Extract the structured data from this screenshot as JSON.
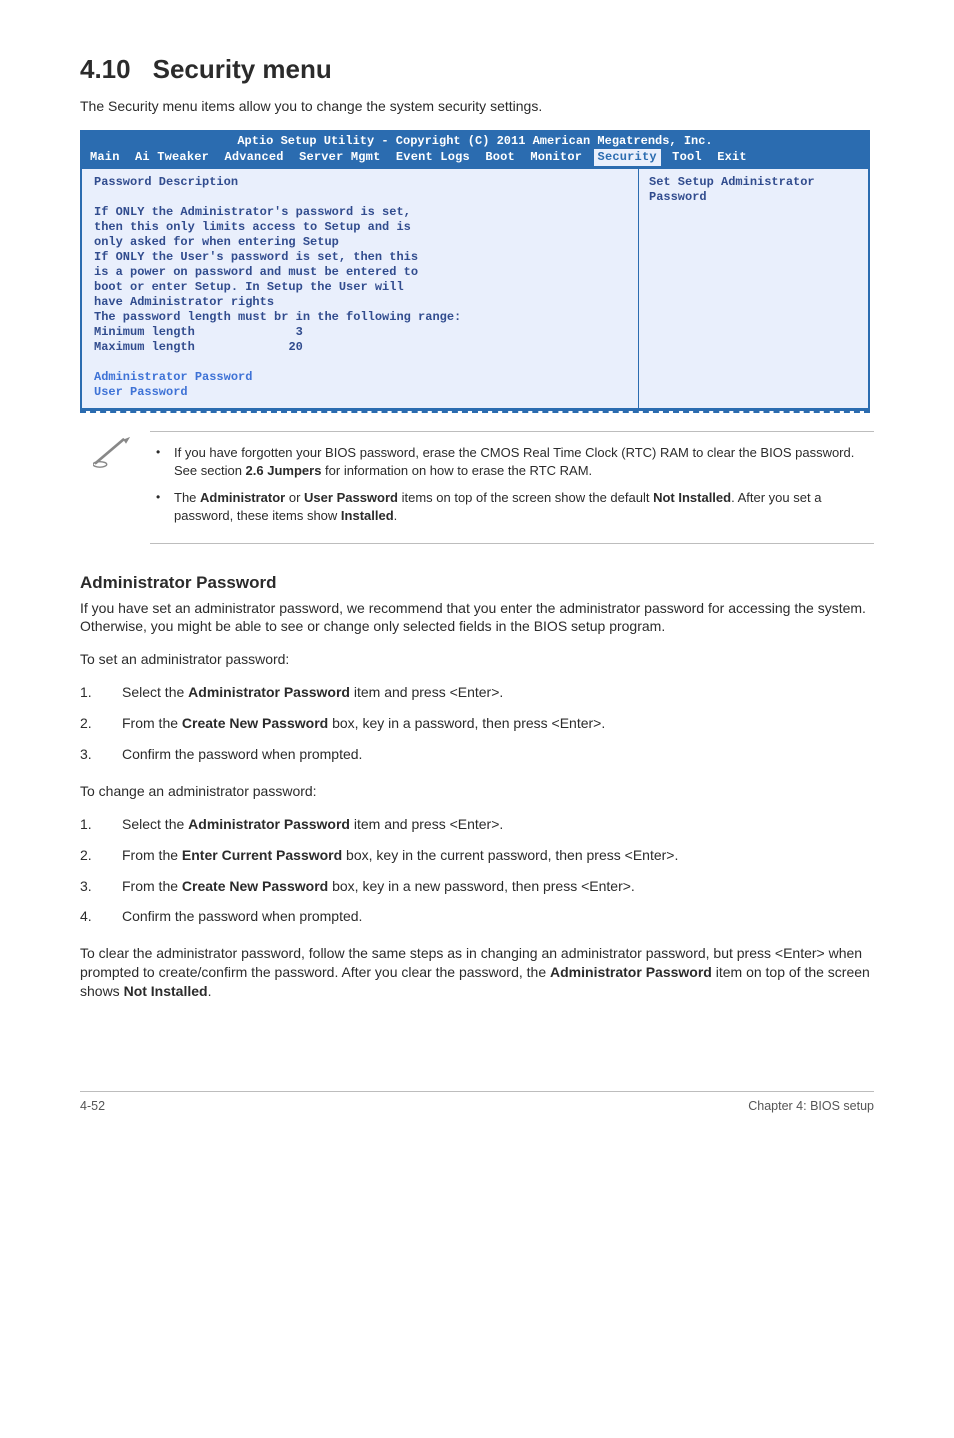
{
  "heading": {
    "num": "4.10",
    "title": "Security menu"
  },
  "intro": "The Security menu items allow you to change the system security settings.",
  "bios": {
    "title": "Aptio Setup Utility - Copyright (C) 2011 American Megatrends, Inc.",
    "tabs": [
      "Main",
      "Ai Tweaker",
      "Advanced",
      "Server Mgmt",
      "Event Logs",
      "Boot",
      "Monitor",
      "Security",
      "Tool",
      "Exit"
    ],
    "active_tab": "Security",
    "left": {
      "l0": "Password Description",
      "l1": "If ONLY the Administrator's password is set,",
      "l2": "then this only limits access to Setup and is",
      "l3": "only asked for when entering Setup",
      "l4": "If ONLY the User's password is set, then this",
      "l5": "is a power on password and must be entered to",
      "l6": "boot or enter Setup. In Setup the User will",
      "l7": "have Administrator rights",
      "l8": "The password length must br in the following range:",
      "l9a": "Minimum length",
      "l9b": "3",
      "l10a": "Maximum length",
      "l10b": "20",
      "admin": "Administrator Password",
      "user": "User Password"
    },
    "right": {
      "r1": "Set Setup Administrator",
      "r2": "Password"
    }
  },
  "note": {
    "b1a": "If you have forgotten your BIOS password, erase the CMOS Real Time Clock (RTC) RAM to clear the BIOS password. See section ",
    "b1b": "2.6 Jumpers",
    "b1c": " for information on how to erase the RTC RAM.",
    "b2a": "The ",
    "b2b": "Administrator",
    "b2c": " or ",
    "b2d": "User Password",
    "b2e": " items on top of the screen show the default ",
    "b2f": "Not Installed",
    "b2g": ". After you set a password, these items show ",
    "b2h": "Installed",
    "b2i": "."
  },
  "admin": {
    "h": "Administrator Password",
    "p": "If you have set an administrator password, we recommend that you enter the administrator password for accessing the system. Otherwise, you might be able to see or change only selected fields in the BIOS setup program.",
    "set_intro": "To set an administrator password:",
    "set": {
      "s1a": "Select the ",
      "s1b": "Administrator Password",
      "s1c": " item and press <Enter>.",
      "s2a": "From the ",
      "s2b": "Create New Password",
      "s2c": " box, key in a password, then press <Enter>.",
      "s3": "Confirm the password when prompted."
    },
    "change_intro": "To change an administrator password:",
    "change": {
      "c1a": "Select the ",
      "c1b": "Administrator Password",
      "c1c": " item and press <Enter>.",
      "c2a": "From the ",
      "c2b": "Enter Current Password",
      "c2c": " box, key in the current password, then press <Enter>.",
      "c3a": "From the ",
      "c3b": "Create New Password",
      "c3c": " box, key in a new password, then press <Enter>.",
      "c4": "Confirm the password when prompted."
    },
    "clear_a": "To clear the administrator password, follow the same steps as in changing an administrator password, but press <Enter> when prompted to create/confirm the password. After you clear the password, the ",
    "clear_b": "Administrator Password",
    "clear_c": " item on top of the screen shows ",
    "clear_d": "Not Installed",
    "clear_e": "."
  },
  "footer": {
    "left": "4-52",
    "right": "Chapter 4: BIOS setup"
  }
}
